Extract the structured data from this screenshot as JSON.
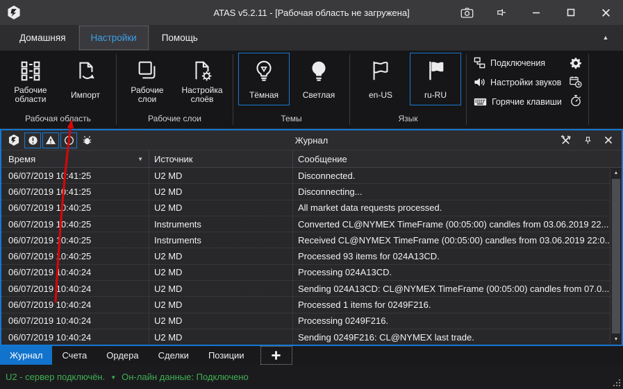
{
  "colors": {
    "accent_blue": "#1478d2",
    "selected_border_blue": "#1a7ad0",
    "active_tab_blue": "#1273cc",
    "status_green": "#3fb052",
    "annotation_red": "#d40808"
  },
  "title_bar": {
    "title": "ATAS v5.2.11 - [Рабочая область не загружена]"
  },
  "menu": {
    "home": "Домашняя",
    "settings": "Настройки",
    "help": "Помощь"
  },
  "ribbon": {
    "workspace_group": {
      "caption": "Рабочая область",
      "workspaces": "Рабочие области",
      "import": "Импорт"
    },
    "layers_group": {
      "caption": "Рабочие слои",
      "layers": "Рабочие слои",
      "layer_settings": "Настройка слоёв"
    },
    "themes_group": {
      "caption": "Темы",
      "dark": "Тёмная",
      "light": "Светлая"
    },
    "language_group": {
      "caption": "Язык",
      "en": "en-US",
      "ru": "ru-RU"
    },
    "quick_group": {
      "connections": "Подключения",
      "sounds": "Настройки звуков",
      "hotkeys": "Горячие клавиши"
    }
  },
  "journal": {
    "title": "Журнал",
    "columns": {
      "time": "Время",
      "source": "Источник",
      "message": "Сообщение"
    },
    "rows": [
      {
        "time": "06/07/2019 10:41:25",
        "source": "U2 MD",
        "message": "Disconnected."
      },
      {
        "time": "06/07/2019 10:41:25",
        "source": "U2 MD",
        "message": "Disconnecting..."
      },
      {
        "time": "06/07/2019 10:40:25",
        "source": "U2 MD",
        "message": "All market data requests processed."
      },
      {
        "time": "06/07/2019 10:40:25",
        "source": "Instruments",
        "message": "Converted CL@NYMEX TimeFrame (00:05:00) candles from 03.06.2019 22..."
      },
      {
        "time": "06/07/2019 10:40:25",
        "source": "Instruments",
        "message": "Received CL@NYMEX TimeFrame (00:05:00) candles from 03.06.2019 22:0..."
      },
      {
        "time": "06/07/2019 10:40:25",
        "source": "U2 MD",
        "message": "Processed 93 items for 024A13CD."
      },
      {
        "time": "06/07/2019 10:40:24",
        "source": "U2 MD",
        "message": "Processing 024A13CD."
      },
      {
        "time": "06/07/2019 10:40:24",
        "source": "U2 MD",
        "message": "Sending 024A13CD: CL@NYMEX TimeFrame (00:05:00) candles from 07.0..."
      },
      {
        "time": "06/07/2019 10:40:24",
        "source": "U2 MD",
        "message": "Processed 1 items for 0249F216."
      },
      {
        "time": "06/07/2019 10:40:24",
        "source": "U2 MD",
        "message": "Processing 0249F216."
      },
      {
        "time": "06/07/2019 10:40:24",
        "source": "U2 MD",
        "message": "Sending 0249F216: CL@NYMEX last trade."
      }
    ]
  },
  "bottom_tabs": {
    "journal": "Журнал",
    "accounts": "Счета",
    "orders": "Ордера",
    "deals": "Сделки",
    "positions": "Позиции"
  },
  "status_bar": {
    "server": "U2 - сервер подключён.",
    "online": "Он-лайн данные: Подключено"
  },
  "icons": {
    "sort_descending": "▼",
    "scroll_up": "▲",
    "scroll_down": "▼",
    "collapse_ribbon": "▲",
    "status_dropdown": "▼"
  }
}
